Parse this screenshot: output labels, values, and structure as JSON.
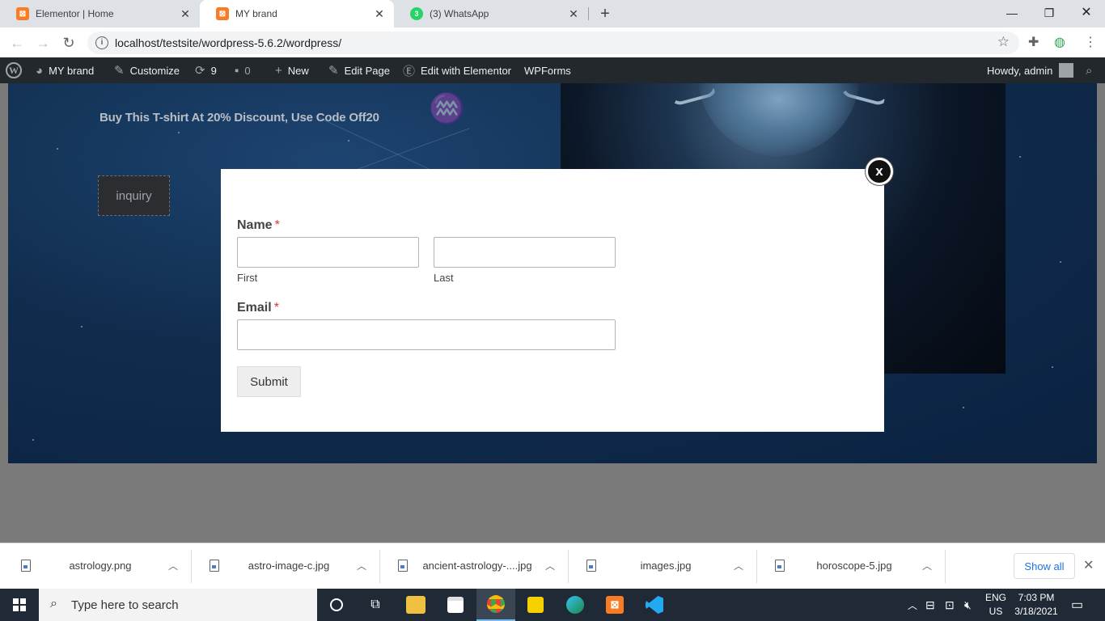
{
  "browser": {
    "tabs": [
      {
        "title": "Elementor | Home",
        "icon": "xampp-icon",
        "active": false
      },
      {
        "title": "MY brand",
        "icon": "xampp-icon",
        "active": true
      },
      {
        "title": "(3) WhatsApp",
        "icon": "whatsapp-icon",
        "active": false
      }
    ],
    "whatsapp_badge": "3",
    "url": "localhost/testsite/wordpress-5.6.2/wordpress/"
  },
  "adminbar": {
    "site_name": "MY brand",
    "customize": "Customize",
    "updates_count": "9",
    "comments_count": "0",
    "new": "New",
    "edit_page": "Edit Page",
    "edit_elementor": "Edit with Elementor",
    "wpforms": "WPForms",
    "howdy": "Howdy, admin"
  },
  "page": {
    "promo_text": "Buy This T-shirt At 20% Discount, Use Code Off20",
    "inquiry_label": "inquiry"
  },
  "popup": {
    "close_label": "x",
    "name_label": "Name",
    "required_mark": "*",
    "first_value": "",
    "last_value": "",
    "first_sublabel": "First",
    "last_sublabel": "Last",
    "email_label": "Email",
    "email_value": "",
    "submit_label": "Submit"
  },
  "downloads": {
    "items": [
      {
        "name": "astrology.png"
      },
      {
        "name": "astro-image-c.jpg"
      },
      {
        "name": "ancient-astrology-....jpg"
      },
      {
        "name": "images.jpg"
      },
      {
        "name": "horoscope-5.jpg"
      }
    ],
    "show_all": "Show all"
  },
  "taskbar": {
    "search_placeholder": "Type here to search",
    "lang_top": "ENG",
    "lang_bottom": "US",
    "time": "7:03 PM",
    "date": "3/18/2021"
  },
  "colors": {
    "adminbar_bg": "#23282d",
    "required": "#d63637",
    "show_all": "#1a73e8",
    "taskbar_bg": "#1f2a36"
  }
}
